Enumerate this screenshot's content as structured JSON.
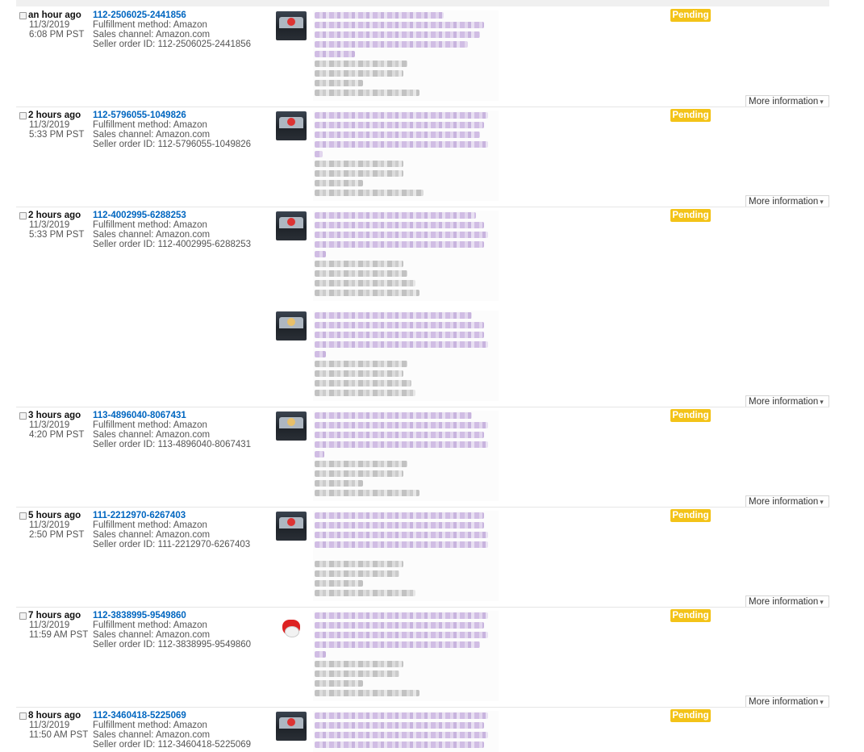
{
  "status_label": "Pending",
  "more_info_label": "More information",
  "fulfillment_text": "Fulfillment method: Amazon",
  "sales_channel_text": "Sales channel: Amazon.com",
  "orders": [
    {
      "ago": "an hour ago",
      "date": "11/3/2019",
      "time": "6:08 PM PST",
      "order_id": "112-2506025-2441856",
      "seller_order": "Seller order ID: 112-2506025-2441856"
    },
    {
      "ago": "2 hours ago",
      "date": "11/3/2019",
      "time": "5:33 PM PST",
      "order_id": "112-5796055-1049826",
      "seller_order": "Seller order ID: 112-5796055-1049826"
    },
    {
      "ago": "2 hours ago",
      "date": "11/3/2019",
      "time": "5:33 PM PST",
      "order_id": "112-4002995-6288253",
      "seller_order": "Seller order ID: 112-4002995-6288253"
    },
    {
      "ago": "3 hours ago",
      "date": "11/3/2019",
      "time": "4:20 PM PST",
      "order_id": "113-4896040-8067431",
      "seller_order": "Seller order ID: 113-4896040-8067431"
    },
    {
      "ago": "5 hours ago",
      "date": "11/3/2019",
      "time": "2:50 PM PST",
      "order_id": "111-2212970-6267403",
      "seller_order": "Seller order ID: 111-2212970-6267403"
    },
    {
      "ago": "7 hours ago",
      "date": "11/3/2019",
      "time": "11:59 AM PST",
      "order_id": "112-3838995-9549860",
      "seller_order": "Seller order ID: 112-3838995-9549860"
    },
    {
      "ago": "8 hours ago",
      "date": "11/3/2019",
      "time": "11:50 AM PST",
      "order_id": "112-3460418-5225069",
      "seller_order": "Seller order ID: 112-3460418-5225069"
    }
  ]
}
